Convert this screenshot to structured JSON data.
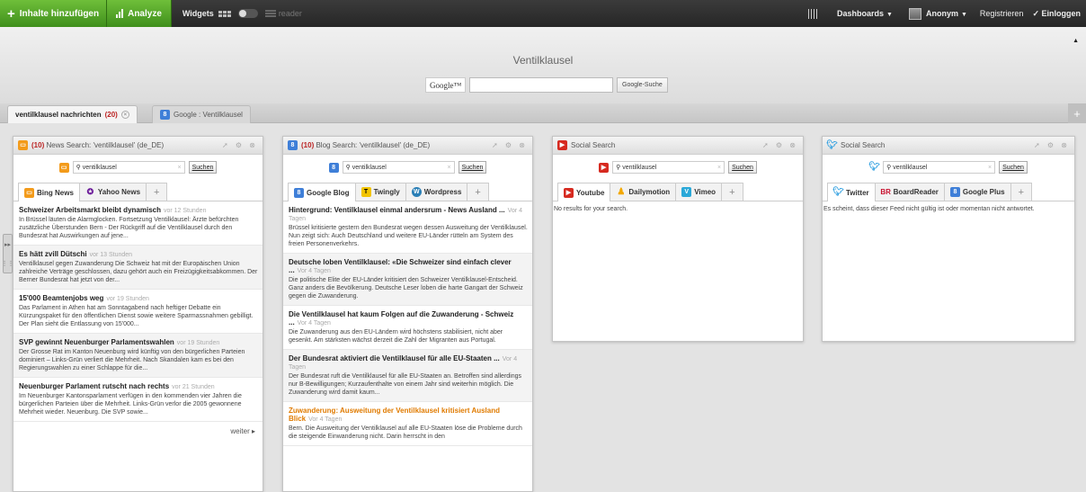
{
  "topbar": {
    "add_content": "Inhalte hinzufügen",
    "analyze": "Analyze",
    "widgets": "Widgets",
    "reader": "reader",
    "dashboards": "Dashboards",
    "user": "Anonym",
    "register": "Registrieren",
    "login": "Einloggen"
  },
  "header": {
    "site_title": "Ventilklausel",
    "google_logo": "Google™",
    "search_value": "",
    "search_button": "Google-Suche"
  },
  "page_tabs": [
    {
      "label": "ventilklausel nachrichten",
      "count": "(20)"
    },
    {
      "label": "Google : Ventilklausel"
    }
  ],
  "widgets": [
    {
      "title_count": "(10)",
      "title": "News Search: 'ventilklausel' (de_DE)",
      "search_value": "ventilklausel",
      "search_button": "Suchen",
      "tabs": [
        "Bing News",
        "Yahoo News"
      ],
      "items": [
        {
          "title": "Schweizer Arbeitsmarkt bleibt dynamisch",
          "time": "vor 12 Stunden",
          "body": "In Brüssel läuten die Alarmglocken. Fortsetzung Ventilklausel: Ärzte befürchten zusätzliche Überstunden Bern - Der Rückgriff auf die Ventilklausel durch den Bundesrat hat Auswirkungen auf jene..."
        },
        {
          "title": "Es hätt zvill Dütschi",
          "time": "vor 13 Stunden",
          "body": "Ventilklausel gegen Zuwanderung Die Schweiz hat mit der Europäischen Union zahlreiche Verträge geschlossen, dazu gehört auch ein Freizügigkeitsabkommen. Der Berner Bundesrat hat jetzt von der..."
        },
        {
          "title": "15'000 Beamtenjobs weg",
          "time": "vor 19 Stunden",
          "body": "Das Parlament in Athen hat am Sonntagabend nach heftiger Debatte ein Kürzungspaket für den öffentlichen Dienst sowie weitere Sparmassnahmen gebilligt. Der Plan sieht die Entlassung von 15'000..."
        },
        {
          "title": "SVP gewinnt Neuenburger Parlamentswahlen",
          "time": "vor 19 Stunden",
          "body": "Der Grosse Rat im Kanton Neuenburg wird künftig von den bürgerlichen Parteien dominiert – Links-Grün verliert die Mehrheit. Nach Skandalen kam es bei den Regierungswahlen zu einer Schlappe für die..."
        },
        {
          "title": "Neuenburger Parlament rutscht nach rechts",
          "time": "vor 21 Stunden",
          "body": "Im Neuenburger Kantonsparlament verfügen in den kommenden vier Jahren die bürgerlichen Parteien über die Mehrheit. Links-Grün verlor die 2005 gewonnene Mehrheit wieder. Neuenburg. Die SVP sowie..."
        }
      ],
      "more": "weiter"
    },
    {
      "title_count": "(10)",
      "title": "Blog Search: 'ventilklausel' (de_DE)",
      "search_value": "ventilklausel",
      "search_button": "Suchen",
      "tabs": [
        "Google Blog",
        "Twingly",
        "Wordpress"
      ],
      "items": [
        {
          "title": "Hintergrund: Ventilklausel einmal andersrum - News Ausland ...",
          "time": "Vor 4 Tagen",
          "body": "Brüssel kritisierte gestern den Bundesrat wegen dessen Ausweitung der Ventilklausel. Nun zeigt sich: Auch Deutschland und weitere EU-Länder rütteln am System des freien Personenverkehrs."
        },
        {
          "title": "Deutsche loben Ventilklausel: «Die Schweizer sind einfach clever ...",
          "time": "Vor 4 Tagen",
          "body": "Die politische Elite der EU-Länder kritisiert den Schweizer Ventilklausel-Entscheid. Ganz anders die Bevölkerung. Deutsche Leser loben die harte Gangart der Schweiz gegen die Zuwanderung."
        },
        {
          "title": "Die Ventilklausel hat kaum Folgen auf die Zuwanderung - Schweiz ...",
          "time": "Vor 4 Tagen",
          "body": "Die Zuwanderung aus den EU-Ländern wird höchstens stabilisiert, nicht aber gesenkt. Am stärksten wächst derzeit die Zahl der Migranten aus Portugal."
        },
        {
          "title": "Der Bundesrat aktiviert die Ventilklausel für alle EU-Staaten ...",
          "time": "Vor 4 Tagen",
          "body": "Der Bundesrat ruft die Ventilklausel für alle EU-Staaten an. Betroffen sind allerdings nur B-Bewilligungen; Kurzaufenthalte von einem Jahr sind weiterhin möglich. Die Zuwanderung wird damit kaum..."
        },
        {
          "title": "Zuwanderung: Ausweitung der Ventilklausel kritisiert Ausland Blick",
          "time": "Vor 4 Tagen",
          "body": "Bern. Die Ausweitung der Ventilklausel auf alle EU-Staaten löse die Probleme durch die steigende Einwanderung nicht. Darin herrscht in den"
        }
      ]
    },
    {
      "title": "Social Search",
      "search_value": "ventilklausel",
      "search_button": "Suchen",
      "tabs": [
        "Youtube",
        "Dailymotion",
        "Vimeo"
      ],
      "message": "No results for your search."
    },
    {
      "title": "Social Search",
      "search_value": "ventilklausel",
      "search_button": "Suchen",
      "tabs": [
        "Twitter",
        "BoardReader",
        "Google Plus"
      ],
      "message": "Es scheint, dass dieser Feed nicht gültig ist oder momentan nicht antwortet."
    }
  ],
  "colors": {
    "topbar": "#2e2e2e",
    "accent_green": "#4fa325",
    "news_icon": "#f39b1b",
    "blog_icon": "#3f7fd8",
    "youtube_icon": "#d62a20",
    "twitter_icon": "#2f9fe0",
    "count_red": "#bb2222"
  }
}
